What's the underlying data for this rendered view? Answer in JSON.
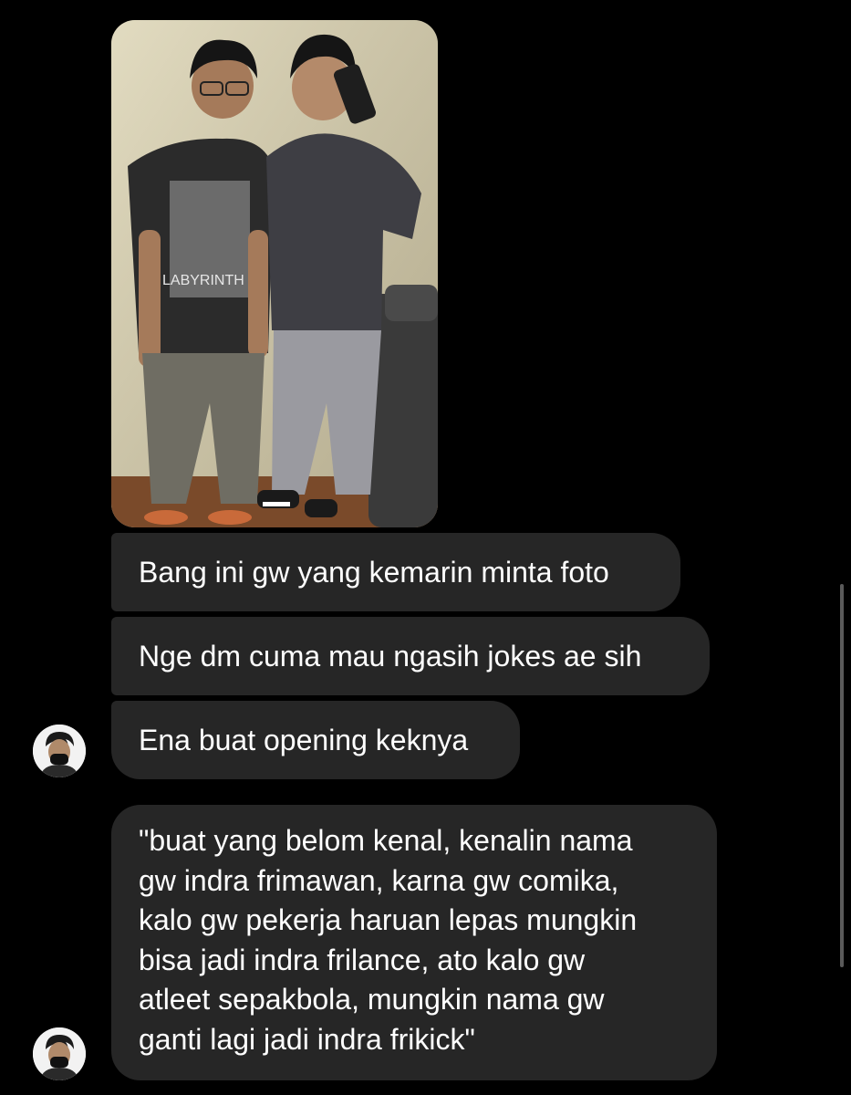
{
  "conversation": {
    "photo": {
      "shirt_print": "LABYRINTH"
    },
    "messages": [
      {
        "text": "Bang ini gw yang kemarin minta foto"
      },
      {
        "text": "Nge dm cuma mau ngasih jokes ae sih"
      },
      {
        "text": "Ena buat opening keknya"
      },
      {
        "lines": [
          "\"buat yang belom kenal, kenalin nama",
          "gw indra frimawan, karna gw comika,",
          "kalo gw pekerja haruan lepas mungkin",
          "bisa jadi indra frilance, ato kalo gw",
          "atleet sepakbola, mungkin nama gw",
          "ganti lagi jadi indra frikick\""
        ]
      }
    ]
  },
  "colors": {
    "background": "#000000",
    "bubble": "#262626",
    "text": "#ffffff"
  },
  "icons": {
    "avatar": "user-avatar-icon"
  }
}
